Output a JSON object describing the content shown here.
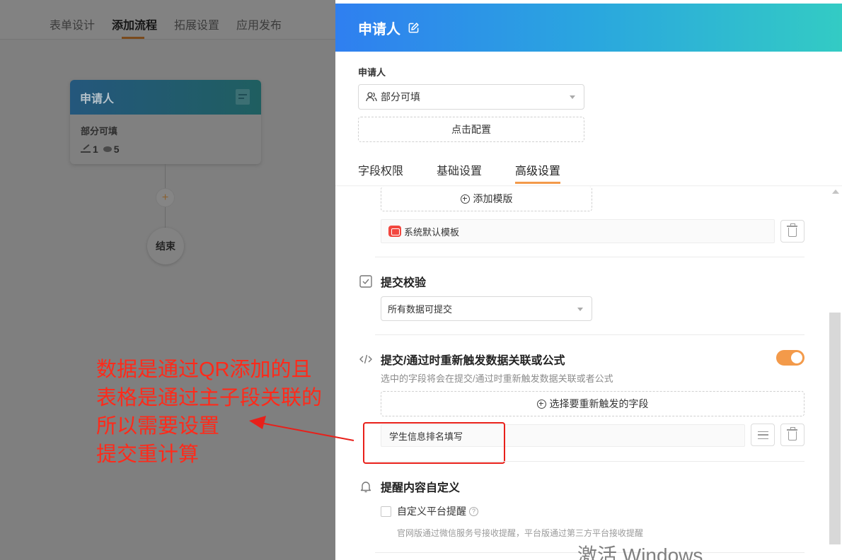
{
  "nav": {
    "tabs": [
      {
        "label": "表单设计",
        "active": false
      },
      {
        "label": "添加流程",
        "active": true
      },
      {
        "label": "拓展设置",
        "active": false
      },
      {
        "label": "应用发布",
        "active": false
      }
    ]
  },
  "flow": {
    "node": {
      "title": "申请人",
      "subtitle": "部分可填",
      "edit_count": "1",
      "view_count": "5"
    },
    "add_symbol": "+",
    "end_label": "结束"
  },
  "annotation": {
    "lines": [
      "数据是通过QR添加的且",
      "表格是通过主子段关联的",
      "所以需要设置",
      "提交重计算"
    ],
    "color": "#ff2a1a"
  },
  "drawer": {
    "title": "申请人",
    "applicant_label": "申请人",
    "applicant_select": "部分可填",
    "config_button": "点击配置",
    "tabs": [
      {
        "label": "字段权限",
        "active": false
      },
      {
        "label": "基础设置",
        "active": false
      },
      {
        "label": "高级设置",
        "active": true
      }
    ],
    "template": {
      "add_button": "添加模版",
      "default_template": "系统默认模板"
    },
    "submit_verify": {
      "title": "提交校验",
      "select_value": "所有数据可提交"
    },
    "retrigger": {
      "title": "提交/通过时重新触发数据关联或公式",
      "enabled": true,
      "description": "选中的字段将会在提交/通过时重新触发数据关联或者公式",
      "choose_button": "选择要重新触发的字段",
      "selected_field": "学生信息排名填写"
    },
    "remind": {
      "title": "提醒内容自定义",
      "checkbox_label": "自定义平台提醒",
      "checked": false,
      "help_symbol": "?",
      "hint": "官网版通过微信服务号接收提醒，平台版通过第三方平台接收提醒"
    }
  },
  "os_watermark": "激活 Windows",
  "colors": {
    "accent": "#f39a4a",
    "header_start": "#2f7ff0",
    "header_end": "#33cbc4",
    "annotation": "#ff2a1a"
  }
}
